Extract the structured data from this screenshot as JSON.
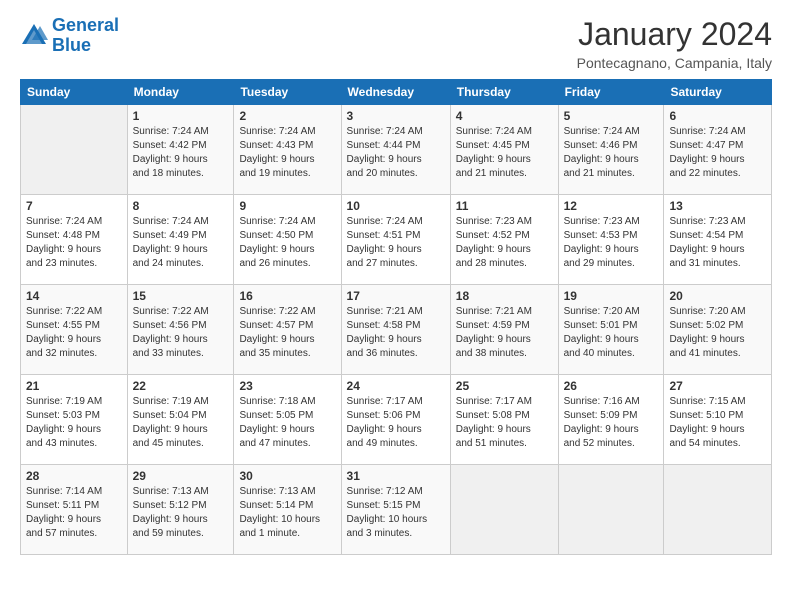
{
  "header": {
    "logo_line1": "General",
    "logo_line2": "Blue",
    "title": "January 2024",
    "location": "Pontecagnano, Campania, Italy"
  },
  "columns": [
    "Sunday",
    "Monday",
    "Tuesday",
    "Wednesday",
    "Thursday",
    "Friday",
    "Saturday"
  ],
  "weeks": [
    [
      {
        "day": "",
        "text": ""
      },
      {
        "day": "1",
        "text": "Sunrise: 7:24 AM\nSunset: 4:42 PM\nDaylight: 9 hours\nand 18 minutes."
      },
      {
        "day": "2",
        "text": "Sunrise: 7:24 AM\nSunset: 4:43 PM\nDaylight: 9 hours\nand 19 minutes."
      },
      {
        "day": "3",
        "text": "Sunrise: 7:24 AM\nSunset: 4:44 PM\nDaylight: 9 hours\nand 20 minutes."
      },
      {
        "day": "4",
        "text": "Sunrise: 7:24 AM\nSunset: 4:45 PM\nDaylight: 9 hours\nand 21 minutes."
      },
      {
        "day": "5",
        "text": "Sunrise: 7:24 AM\nSunset: 4:46 PM\nDaylight: 9 hours\nand 21 minutes."
      },
      {
        "day": "6",
        "text": "Sunrise: 7:24 AM\nSunset: 4:47 PM\nDaylight: 9 hours\nand 22 minutes."
      }
    ],
    [
      {
        "day": "7",
        "text": "Sunrise: 7:24 AM\nSunset: 4:48 PM\nDaylight: 9 hours\nand 23 minutes."
      },
      {
        "day": "8",
        "text": "Sunrise: 7:24 AM\nSunset: 4:49 PM\nDaylight: 9 hours\nand 24 minutes."
      },
      {
        "day": "9",
        "text": "Sunrise: 7:24 AM\nSunset: 4:50 PM\nDaylight: 9 hours\nand 26 minutes."
      },
      {
        "day": "10",
        "text": "Sunrise: 7:24 AM\nSunset: 4:51 PM\nDaylight: 9 hours\nand 27 minutes."
      },
      {
        "day": "11",
        "text": "Sunrise: 7:23 AM\nSunset: 4:52 PM\nDaylight: 9 hours\nand 28 minutes."
      },
      {
        "day": "12",
        "text": "Sunrise: 7:23 AM\nSunset: 4:53 PM\nDaylight: 9 hours\nand 29 minutes."
      },
      {
        "day": "13",
        "text": "Sunrise: 7:23 AM\nSunset: 4:54 PM\nDaylight: 9 hours\nand 31 minutes."
      }
    ],
    [
      {
        "day": "14",
        "text": "Sunrise: 7:22 AM\nSunset: 4:55 PM\nDaylight: 9 hours\nand 32 minutes."
      },
      {
        "day": "15",
        "text": "Sunrise: 7:22 AM\nSunset: 4:56 PM\nDaylight: 9 hours\nand 33 minutes."
      },
      {
        "day": "16",
        "text": "Sunrise: 7:22 AM\nSunset: 4:57 PM\nDaylight: 9 hours\nand 35 minutes."
      },
      {
        "day": "17",
        "text": "Sunrise: 7:21 AM\nSunset: 4:58 PM\nDaylight: 9 hours\nand 36 minutes."
      },
      {
        "day": "18",
        "text": "Sunrise: 7:21 AM\nSunset: 4:59 PM\nDaylight: 9 hours\nand 38 minutes."
      },
      {
        "day": "19",
        "text": "Sunrise: 7:20 AM\nSunset: 5:01 PM\nDaylight: 9 hours\nand 40 minutes."
      },
      {
        "day": "20",
        "text": "Sunrise: 7:20 AM\nSunset: 5:02 PM\nDaylight: 9 hours\nand 41 minutes."
      }
    ],
    [
      {
        "day": "21",
        "text": "Sunrise: 7:19 AM\nSunset: 5:03 PM\nDaylight: 9 hours\nand 43 minutes."
      },
      {
        "day": "22",
        "text": "Sunrise: 7:19 AM\nSunset: 5:04 PM\nDaylight: 9 hours\nand 45 minutes."
      },
      {
        "day": "23",
        "text": "Sunrise: 7:18 AM\nSunset: 5:05 PM\nDaylight: 9 hours\nand 47 minutes."
      },
      {
        "day": "24",
        "text": "Sunrise: 7:17 AM\nSunset: 5:06 PM\nDaylight: 9 hours\nand 49 minutes."
      },
      {
        "day": "25",
        "text": "Sunrise: 7:17 AM\nSunset: 5:08 PM\nDaylight: 9 hours\nand 51 minutes."
      },
      {
        "day": "26",
        "text": "Sunrise: 7:16 AM\nSunset: 5:09 PM\nDaylight: 9 hours\nand 52 minutes."
      },
      {
        "day": "27",
        "text": "Sunrise: 7:15 AM\nSunset: 5:10 PM\nDaylight: 9 hours\nand 54 minutes."
      }
    ],
    [
      {
        "day": "28",
        "text": "Sunrise: 7:14 AM\nSunset: 5:11 PM\nDaylight: 9 hours\nand 57 minutes."
      },
      {
        "day": "29",
        "text": "Sunrise: 7:13 AM\nSunset: 5:12 PM\nDaylight: 9 hours\nand 59 minutes."
      },
      {
        "day": "30",
        "text": "Sunrise: 7:13 AM\nSunset: 5:14 PM\nDaylight: 10 hours\nand 1 minute."
      },
      {
        "day": "31",
        "text": "Sunrise: 7:12 AM\nSunset: 5:15 PM\nDaylight: 10 hours\nand 3 minutes."
      },
      {
        "day": "",
        "text": ""
      },
      {
        "day": "",
        "text": ""
      },
      {
        "day": "",
        "text": ""
      }
    ]
  ]
}
